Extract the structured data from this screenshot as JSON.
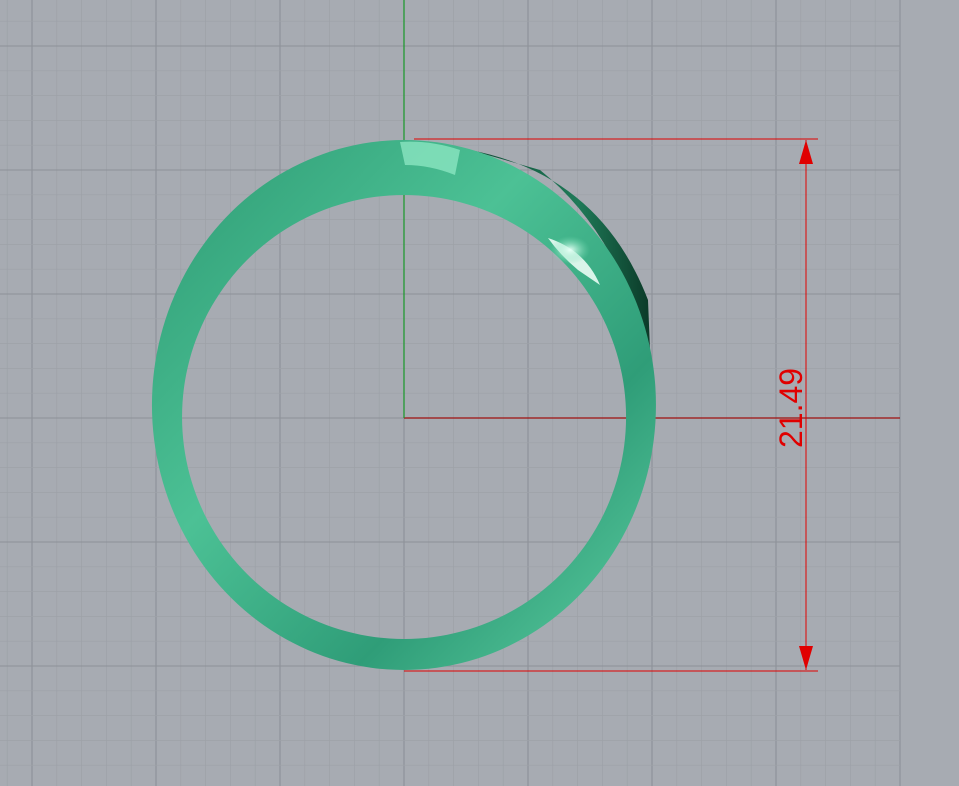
{
  "viewport": {
    "background_color": "#a7abb2",
    "grid_minor_color": "#9da1a8",
    "grid_major_color": "#8d9198",
    "x_axis_color": "#a01010",
    "y_axis_color": "#1a9a2a"
  },
  "model": {
    "object": "ring",
    "color": "#3aa887"
  },
  "dimension": {
    "label": "21.49",
    "color": "#e00000"
  }
}
